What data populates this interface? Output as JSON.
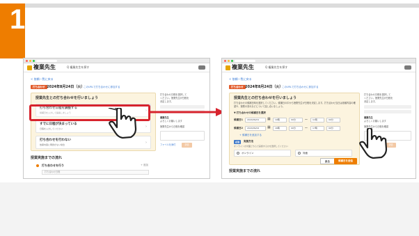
{
  "step": {
    "number": "1",
    "color": "#ee7d00"
  },
  "app": {
    "logo": "複業先生",
    "nav_link": "Q 複業先生を探す",
    "back_link": "< 依頼一覧に戻る",
    "date_tag": "打ち合わせ",
    "date_text": "2024年8月24日（火）",
    "sub_link": "このURLで打ち合わせに参加する"
  },
  "left_screen": {
    "panel_title": "授業先生との打ち合わせを行いましょう",
    "options": [
      {
        "title": "打ち合わせ日程を調整する",
        "sub": "候補日を入力して提案しましょう"
      },
      {
        "title": "すでに日程が決まっている",
        "sub": "日程を入力してください"
      },
      {
        "title": "打ち合わせを行わない",
        "sub": "依頼内容に問題がない場合"
      }
    ],
    "section_title": "授業実施までの流れ",
    "flow_item": "打ち合わせを行う",
    "flow_add": "+ 追加",
    "flow_field": "打ち合わせ日程"
  },
  "right_screen": {
    "panel_title": "授業先生との打ち合わせを行いましょう",
    "description": "打ち合わせの候補日時を選択してください。候補日の中から授業先生が日程を決定します。打ち合わせ当日は依頼内容の確認や、授業の流れなどについて話し合いましょう。",
    "candidates_heading": "▼ 打ち合わせの候補日を選択",
    "candidates": [
      {
        "label": "候補日1",
        "date": "2024/09/01",
        "from_h": "10時",
        "from_m": "00分",
        "to_h": "11時",
        "to_m": "00分"
      },
      {
        "label": "候補日2",
        "date": "2024/09/02",
        "from_h": "16時",
        "from_m": "00分",
        "to_h": "17時",
        "to_m": "00分"
      }
    ],
    "add_candidate": "+ 候補日を追加する",
    "method_tag": "必須",
    "method_label": "実施方法",
    "method_note": "オンラインか対面どちらで実施するかを選択してください",
    "radio_online": "オンライン",
    "radio_offline": "対面",
    "btn_back": "戻る",
    "btn_save": "候補日を送信",
    "section_title": "授業実施までの流れ"
  },
  "sidebar": {
    "notes": [
      "打ち合わせ日程を選択して",
      "ください。授業先生が日程を",
      "決定します。"
    ],
    "name": "複業先生",
    "message": "よろしくお願いします",
    "checkbox": "授業先生から日程を確認",
    "file_link": "ファイルを添付",
    "send": "送信"
  },
  "colors": {
    "accent": "#ee7d00",
    "highlight": "#d7232d",
    "panel": "#fcf4df"
  },
  "icons": [
    "hand-pointer-icon",
    "arrow-right-icon",
    "calendar-icon",
    "car-icon"
  ]
}
